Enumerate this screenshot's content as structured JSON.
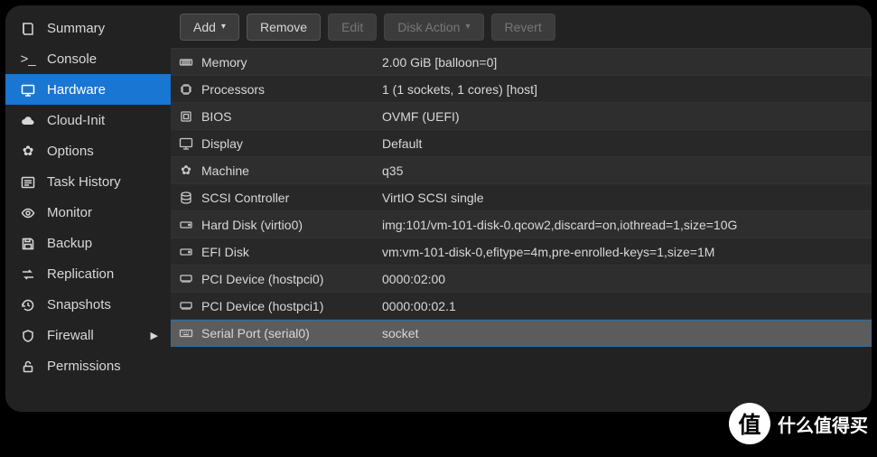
{
  "sidebar": {
    "items": [
      {
        "icon": "book",
        "label": "Summary"
      },
      {
        "icon": "terminal",
        "label": "Console"
      },
      {
        "icon": "monitor",
        "label": "Hardware"
      },
      {
        "icon": "cloud",
        "label": "Cloud-Init"
      },
      {
        "icon": "gear",
        "label": "Options"
      },
      {
        "icon": "list",
        "label": "Task History"
      },
      {
        "icon": "eye",
        "label": "Monitor"
      },
      {
        "icon": "save",
        "label": "Backup"
      },
      {
        "icon": "replicate",
        "label": "Replication"
      },
      {
        "icon": "history",
        "label": "Snapshots"
      },
      {
        "icon": "shield",
        "label": "Firewall"
      },
      {
        "icon": "unlock",
        "label": "Permissions"
      }
    ]
  },
  "toolbar": {
    "add": "Add",
    "remove": "Remove",
    "edit": "Edit",
    "disk_action": "Disk Action",
    "revert": "Revert"
  },
  "hardware": {
    "rows": [
      {
        "icon": "memory",
        "label": "Memory",
        "value": "2.00 GiB [balloon=0]"
      },
      {
        "icon": "cpu",
        "label": "Processors",
        "value": "1 (1 sockets, 1 cores) [host]"
      },
      {
        "icon": "chip",
        "label": "BIOS",
        "value": "OVMF (UEFI)"
      },
      {
        "icon": "monitor",
        "label": "Display",
        "value": "Default"
      },
      {
        "icon": "gear",
        "label": "Machine",
        "value": "q35"
      },
      {
        "icon": "db",
        "label": "SCSI Controller",
        "value": "VirtIO SCSI single"
      },
      {
        "icon": "hdd",
        "label": "Hard Disk (virtio0)",
        "value": "img:101/vm-101-disk-0.qcow2,discard=on,iothread=1,size=10G"
      },
      {
        "icon": "hdd",
        "label": "EFI Disk",
        "value": "vm:vm-101-disk-0,efitype=4m,pre-enrolled-keys=1,size=1M"
      },
      {
        "icon": "pci",
        "label": "PCI Device (hostpci0)",
        "value": "0000:02:00"
      },
      {
        "icon": "pci",
        "label": "PCI Device (hostpci1)",
        "value": "0000:00:02.1"
      },
      {
        "icon": "keyboard",
        "label": "Serial Port (serial0)",
        "value": "socket"
      }
    ]
  },
  "watermark": {
    "badge": "值",
    "text": "什么值得买"
  }
}
